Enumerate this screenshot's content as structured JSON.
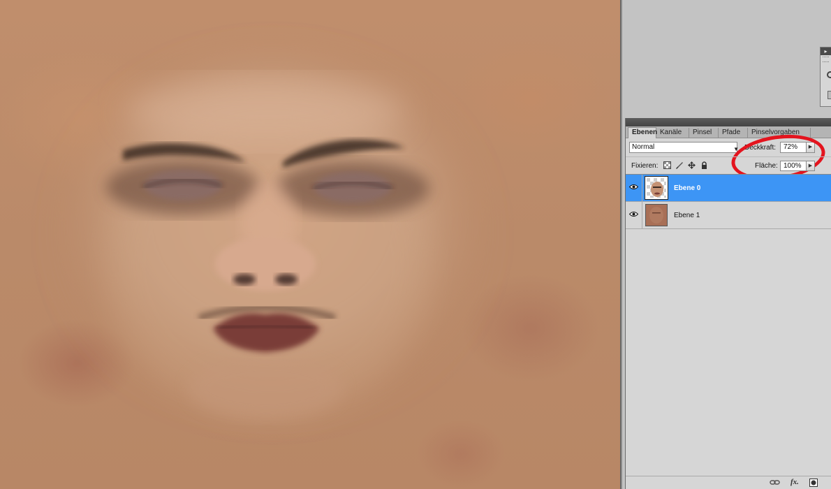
{
  "canvas": {
    "content": "face texture over skin-tone background"
  },
  "layers_panel": {
    "tabs": [
      {
        "label": "Ebenen",
        "active": true
      },
      {
        "label": "Kanäle",
        "active": false
      },
      {
        "label": "Pinsel",
        "active": false
      },
      {
        "label": "Pfade",
        "active": false
      },
      {
        "label": "Pinselvorgaben",
        "active": false
      }
    ],
    "blend_mode": "Normal",
    "opacity_label": "Deckkraft:",
    "opacity_value": "72%",
    "lock_label": "Fixieren:",
    "fill_label": "Fläche:",
    "fill_value": "100%",
    "layers": [
      {
        "name": "Ebene 0",
        "selected": true,
        "visible": true,
        "thumbnail": "face-on-transparency"
      },
      {
        "name": "Ebene 1",
        "selected": false,
        "visible": true,
        "thumbnail": "skin-texture"
      }
    ],
    "footer_icons": [
      "link-layers-icon",
      "fx-icon",
      "layer-mask-icon"
    ]
  },
  "highlight": {
    "color": "#e4141e",
    "target": "opacity control"
  },
  "colors": {
    "selection": "#3d95f5",
    "panel_bg": "#d6d6d6",
    "canvas_skin": "#bb8a69"
  }
}
